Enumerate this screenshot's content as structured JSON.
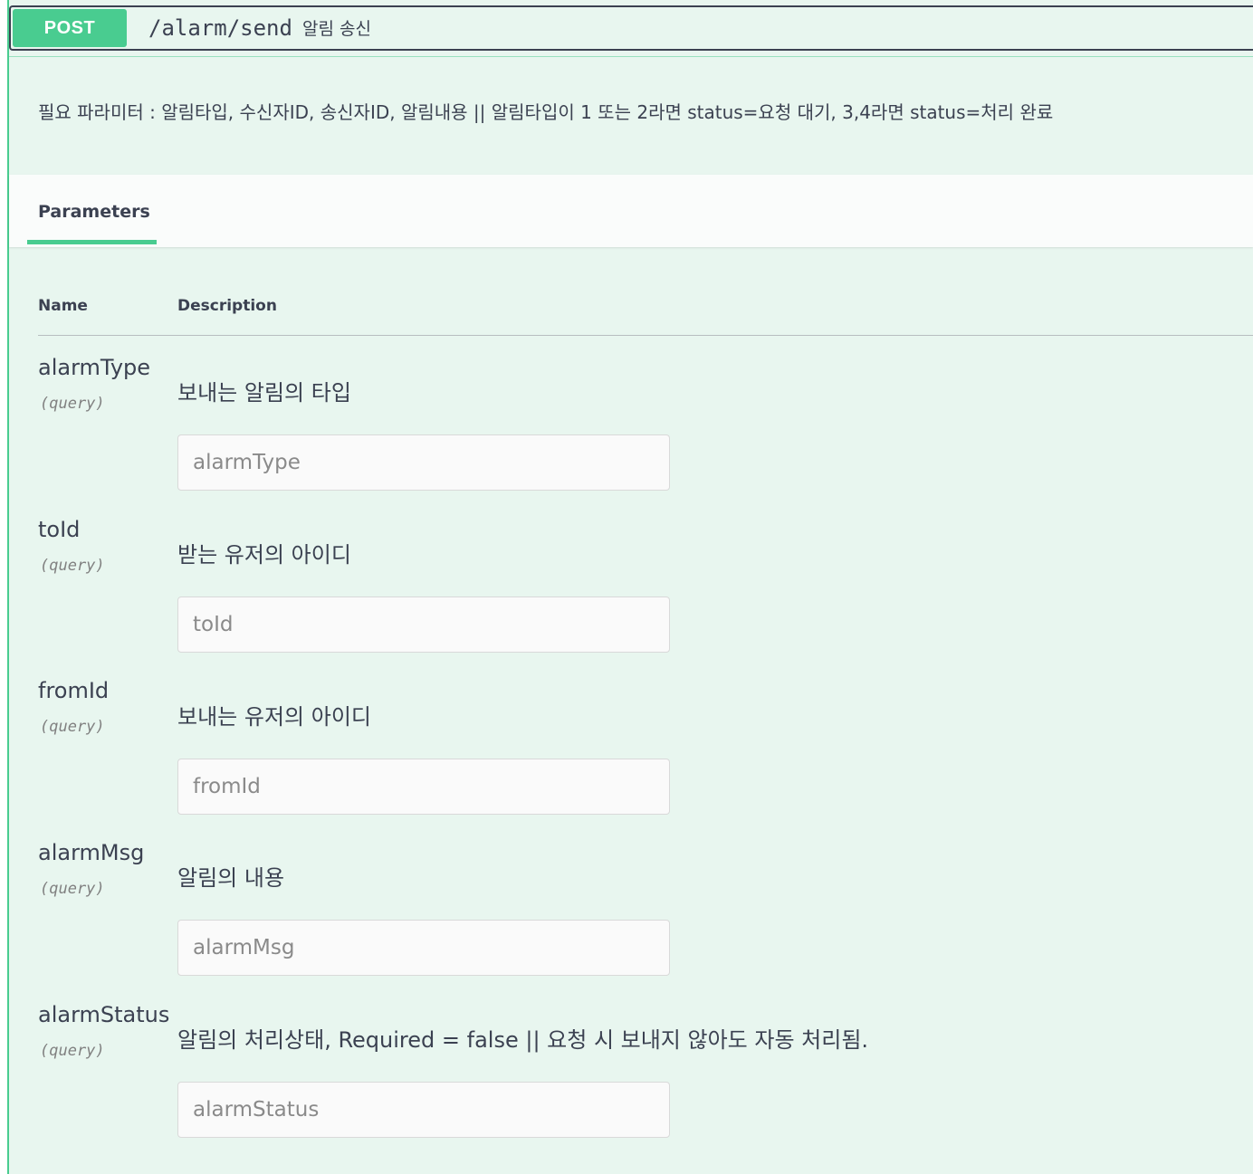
{
  "operation": {
    "method": "POST",
    "path": "/alarm/send",
    "summary": "알림 송신",
    "description": "필요 파라미터 : 알림타입, 수신자ID, 송신자ID, 알림내용 || 알림타입이 1 또는 2라면 status=요청 대기, 3,4라면 status=처리 완료"
  },
  "tabs": {
    "parameters_label": "Parameters"
  },
  "table": {
    "col_name": "Name",
    "col_description": "Description"
  },
  "parameters": [
    {
      "name": "alarmType",
      "in": "(query)",
      "description": "보내는 알림의 타입",
      "placeholder": "alarmType"
    },
    {
      "name": "toId",
      "in": "(query)",
      "description": "받는 유저의 아이디",
      "placeholder": "toId"
    },
    {
      "name": "fromId",
      "in": "(query)",
      "description": "보내는 유저의 아이디",
      "placeholder": "fromId"
    },
    {
      "name": "alarmMsg",
      "in": "(query)",
      "description": "알림의 내용",
      "placeholder": "alarmMsg"
    },
    {
      "name": "alarmStatus",
      "in": "(query)",
      "description": "알림의 처리상태, Required = false || 요청 시 보내지 않아도 자동 처리됨.",
      "placeholder": "alarmStatus"
    }
  ],
  "colors": {
    "method_post": "#49cc90",
    "block_background": "#e8f6ef",
    "text": "#3b4151"
  }
}
